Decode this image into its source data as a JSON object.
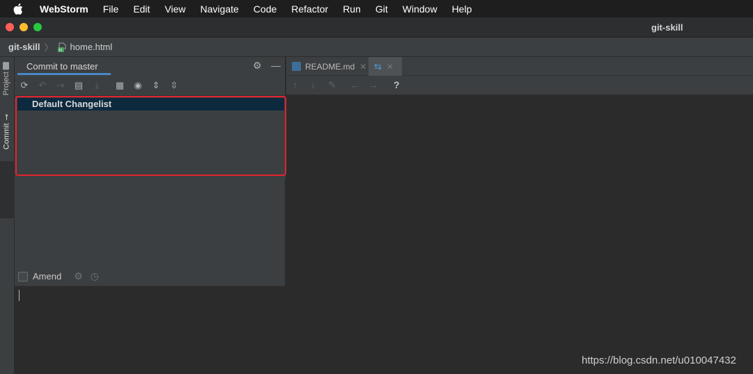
{
  "menubar": {
    "app_name": "WebStorm",
    "items": [
      "File",
      "Edit",
      "View",
      "Navigate",
      "Code",
      "Refactor",
      "Run",
      "Git",
      "Window",
      "Help"
    ]
  },
  "window": {
    "title": "git-skill"
  },
  "breadcrumb": {
    "root": "git-skill",
    "file": "home.html"
  },
  "tool_stripe": {
    "project_label": "Project",
    "commit_label": "Commit"
  },
  "commit_panel": {
    "title": "Commit to master",
    "changelist": "Default Changelist",
    "amend_label": "Amend",
    "amend_checked": false
  },
  "editor": {
    "tabs": [
      {
        "label": "README.md",
        "icon": "markdown-file-icon"
      },
      {
        "label": "",
        "icon": "diff-icon",
        "active": true
      }
    ],
    "help_label": "?"
  },
  "watermark": "https://blog.csdn.net/u010047432",
  "colors": {
    "accent": "#4a88c7",
    "highlight_box": "#e3222f",
    "selection": "#0d293e"
  }
}
